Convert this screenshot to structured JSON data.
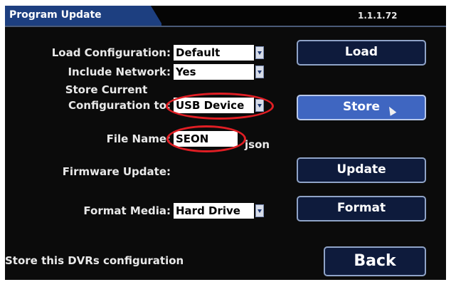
{
  "title": "Program Update",
  "version": "1.1.1.72",
  "fields": {
    "load_config": {
      "label": "Load Configuration:",
      "value": "Default"
    },
    "include_network": {
      "label": "Include Network:",
      "value": "Yes"
    },
    "store_current": {
      "label_line1": "Store Current",
      "label_line2": "Configuration to:",
      "value": "USB Device"
    },
    "file_name": {
      "label": "File Name:",
      "value": "SEON",
      "suffix": "json"
    },
    "firmware": {
      "label": "Firmware Update:"
    },
    "format_media": {
      "label": "Format Media:",
      "value": "Hard Drive"
    }
  },
  "buttons": {
    "load": "Load",
    "store": "Store",
    "update": "Update",
    "format": "Format",
    "back": "Back"
  },
  "status_text": "Store this DVRs configuration",
  "annotation_color": "#e01e24"
}
